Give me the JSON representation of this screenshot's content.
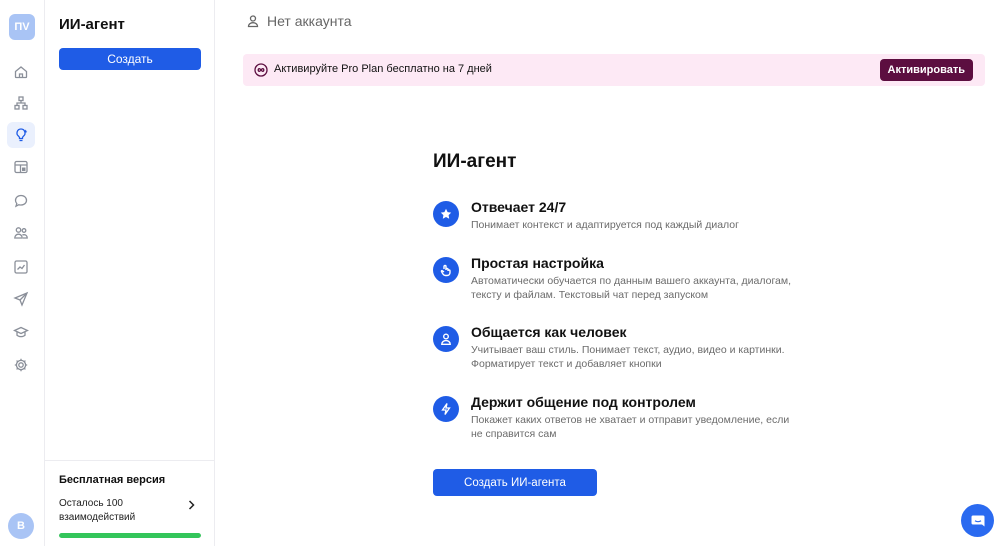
{
  "workspace": {
    "initials": "ПV"
  },
  "user": {
    "initial": "B"
  },
  "rail": {
    "items": [
      {
        "name": "home-icon"
      },
      {
        "name": "sitemap-icon"
      },
      {
        "name": "lightbulb-icon",
        "active": true
      },
      {
        "name": "table-icon"
      },
      {
        "name": "chat-icon"
      },
      {
        "name": "users-icon"
      },
      {
        "name": "chart-icon"
      },
      {
        "name": "send-icon"
      },
      {
        "name": "graduation-cap-icon"
      },
      {
        "name": "settings-icon"
      }
    ]
  },
  "panel": {
    "title": "ИИ-агент",
    "create_label": "Создать",
    "plan": {
      "title": "Бесплатная версия",
      "remaining": "Осталось 100 взаимодействий",
      "progress": 1.0
    }
  },
  "header": {
    "account_label": "Нет аккаунта"
  },
  "promo": {
    "text": "Активируйте Pro Plan бесплатно на 7 дней",
    "button_label": "Активировать"
  },
  "main": {
    "title": "ИИ-агент",
    "features": [
      {
        "icon": "star-icon",
        "title": "Отвечает 24/7",
        "desc": "Понимает контекст и адаптируется под каждый диалог"
      },
      {
        "icon": "setup-icon",
        "title": "Простая настройка",
        "desc": "Автоматически обучается по данным вашего аккаунта, диалогам, тексту и файлам. Текстовый чат перед запуском"
      },
      {
        "icon": "person-icon",
        "title": "Общается как человек",
        "desc": "Учитывает ваш стиль. Понимает текст, аудио, видео и картинки. Форматирует текст и добавляет кнопки"
      },
      {
        "icon": "lightning-icon",
        "title": "Держит общение под контролем",
        "desc": "Покажет каких ответов не хватает и отправит уведомление, если не справится сам"
      }
    ],
    "cta_label": "Создать ИИ-агента"
  },
  "colors": {
    "accent": "#1f5ce6",
    "promo_bg": "#fde9f5",
    "promo_button": "#5c0e40",
    "progress": "#33c55a"
  }
}
